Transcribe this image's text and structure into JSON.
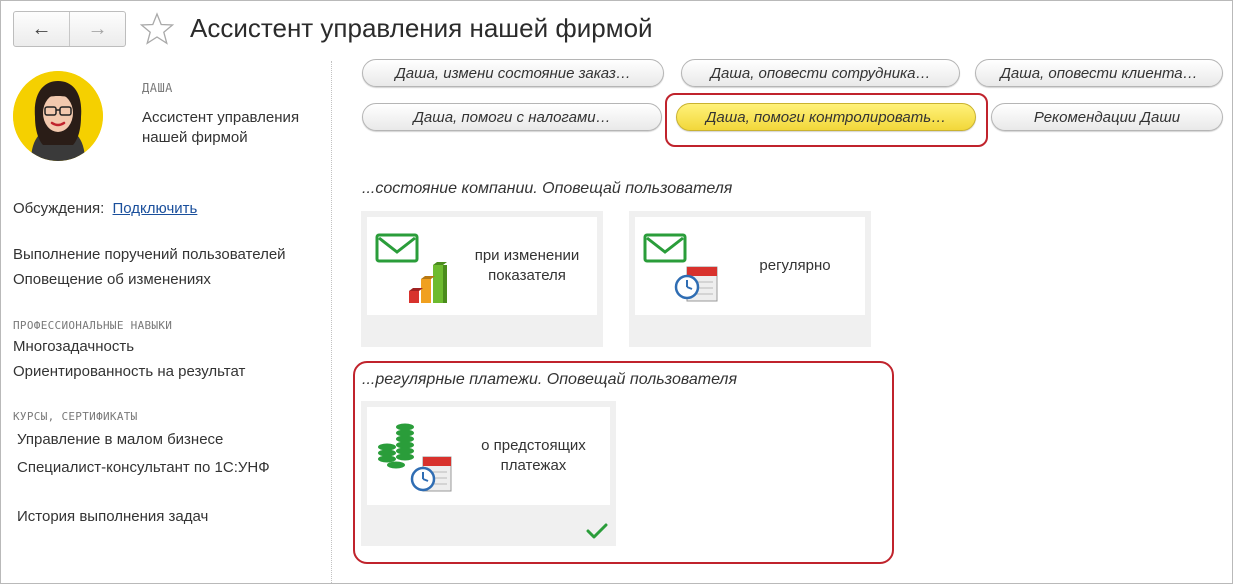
{
  "header": {
    "title": "Ассистент управления нашей фирмой",
    "back_icon": "←",
    "forward_icon": "→"
  },
  "profile": {
    "name": "ДАША",
    "role": "Ассистент управления нашей фирмой",
    "discussions_label": "Обсуждения:",
    "discussions_link": "Подключить"
  },
  "duties": [
    "Выполнение поручений пользователей",
    "Оповещение об изменениях"
  ],
  "skills": {
    "heading": "ПРОФЕССИОНАЛЬНЫЕ НАВЫКИ",
    "items": [
      "Многозадачность",
      "Ориентированность на результат"
    ]
  },
  "courses": {
    "heading": "КУРСЫ, СЕРТИФИКАТЫ",
    "items": [
      "Управление в малом бизнесе",
      "Специалист-консультант по 1С:УНФ"
    ]
  },
  "history_label": "История выполнения задач",
  "commands": [
    "Даша, измени состояние заказ…",
    "Даша, оповести сотрудника…",
    "Даша, оповести клиента…",
    "Даша, помоги с налогами…",
    "Даша, помоги контролировать…",
    "Рекомендации Даши"
  ],
  "groups": [
    {
      "title": "...состояние компании. Оповещай пользователя",
      "tiles": [
        {
          "label": "при изменении показателя"
        },
        {
          "label": "регулярно"
        }
      ]
    },
    {
      "title": "...регулярные платежи. Оповещай пользователя",
      "tiles": [
        {
          "label": "о предстоящих платежах"
        }
      ]
    }
  ],
  "colors": {
    "accent_red": "#c0232c",
    "active_yellow": "#f2d73a",
    "icon_green": "#2a9d3a",
    "link_blue": "#1a4f9c"
  }
}
